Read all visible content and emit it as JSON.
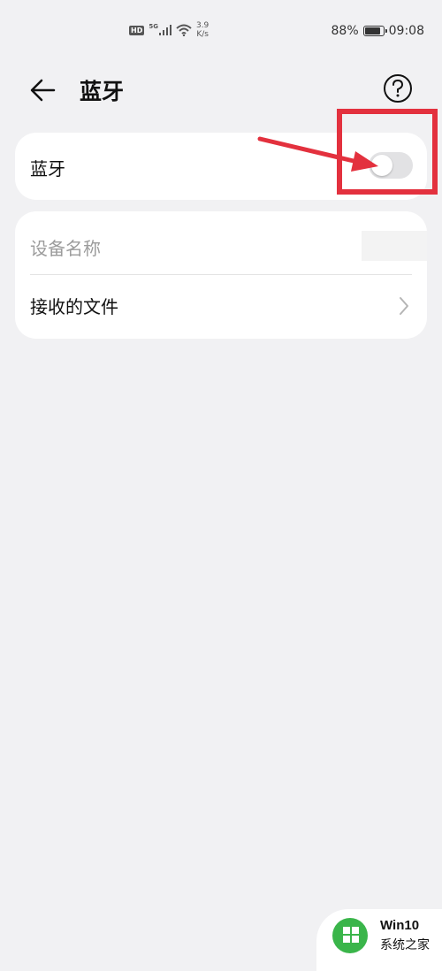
{
  "status_bar": {
    "hd": "HD",
    "network": "5G",
    "speed_value": "3.9",
    "speed_unit": "K/s",
    "battery_percent": "88%",
    "battery_level": 0.88,
    "time": "09:08"
  },
  "header": {
    "title": "蓝牙",
    "back_icon": "back-arrow-icon",
    "help_icon": "help-icon"
  },
  "bluetooth": {
    "label": "蓝牙",
    "enabled": false
  },
  "device_name": {
    "label": "设备名称"
  },
  "received_files": {
    "label": "接收的文件"
  },
  "colors": {
    "background": "#f1f1f3",
    "card": "#ffffff",
    "toggle_off": "#e2e2e4",
    "annotation": "#e3313e"
  },
  "watermark": {
    "line1": "Win10",
    "line2": "系统之家"
  }
}
